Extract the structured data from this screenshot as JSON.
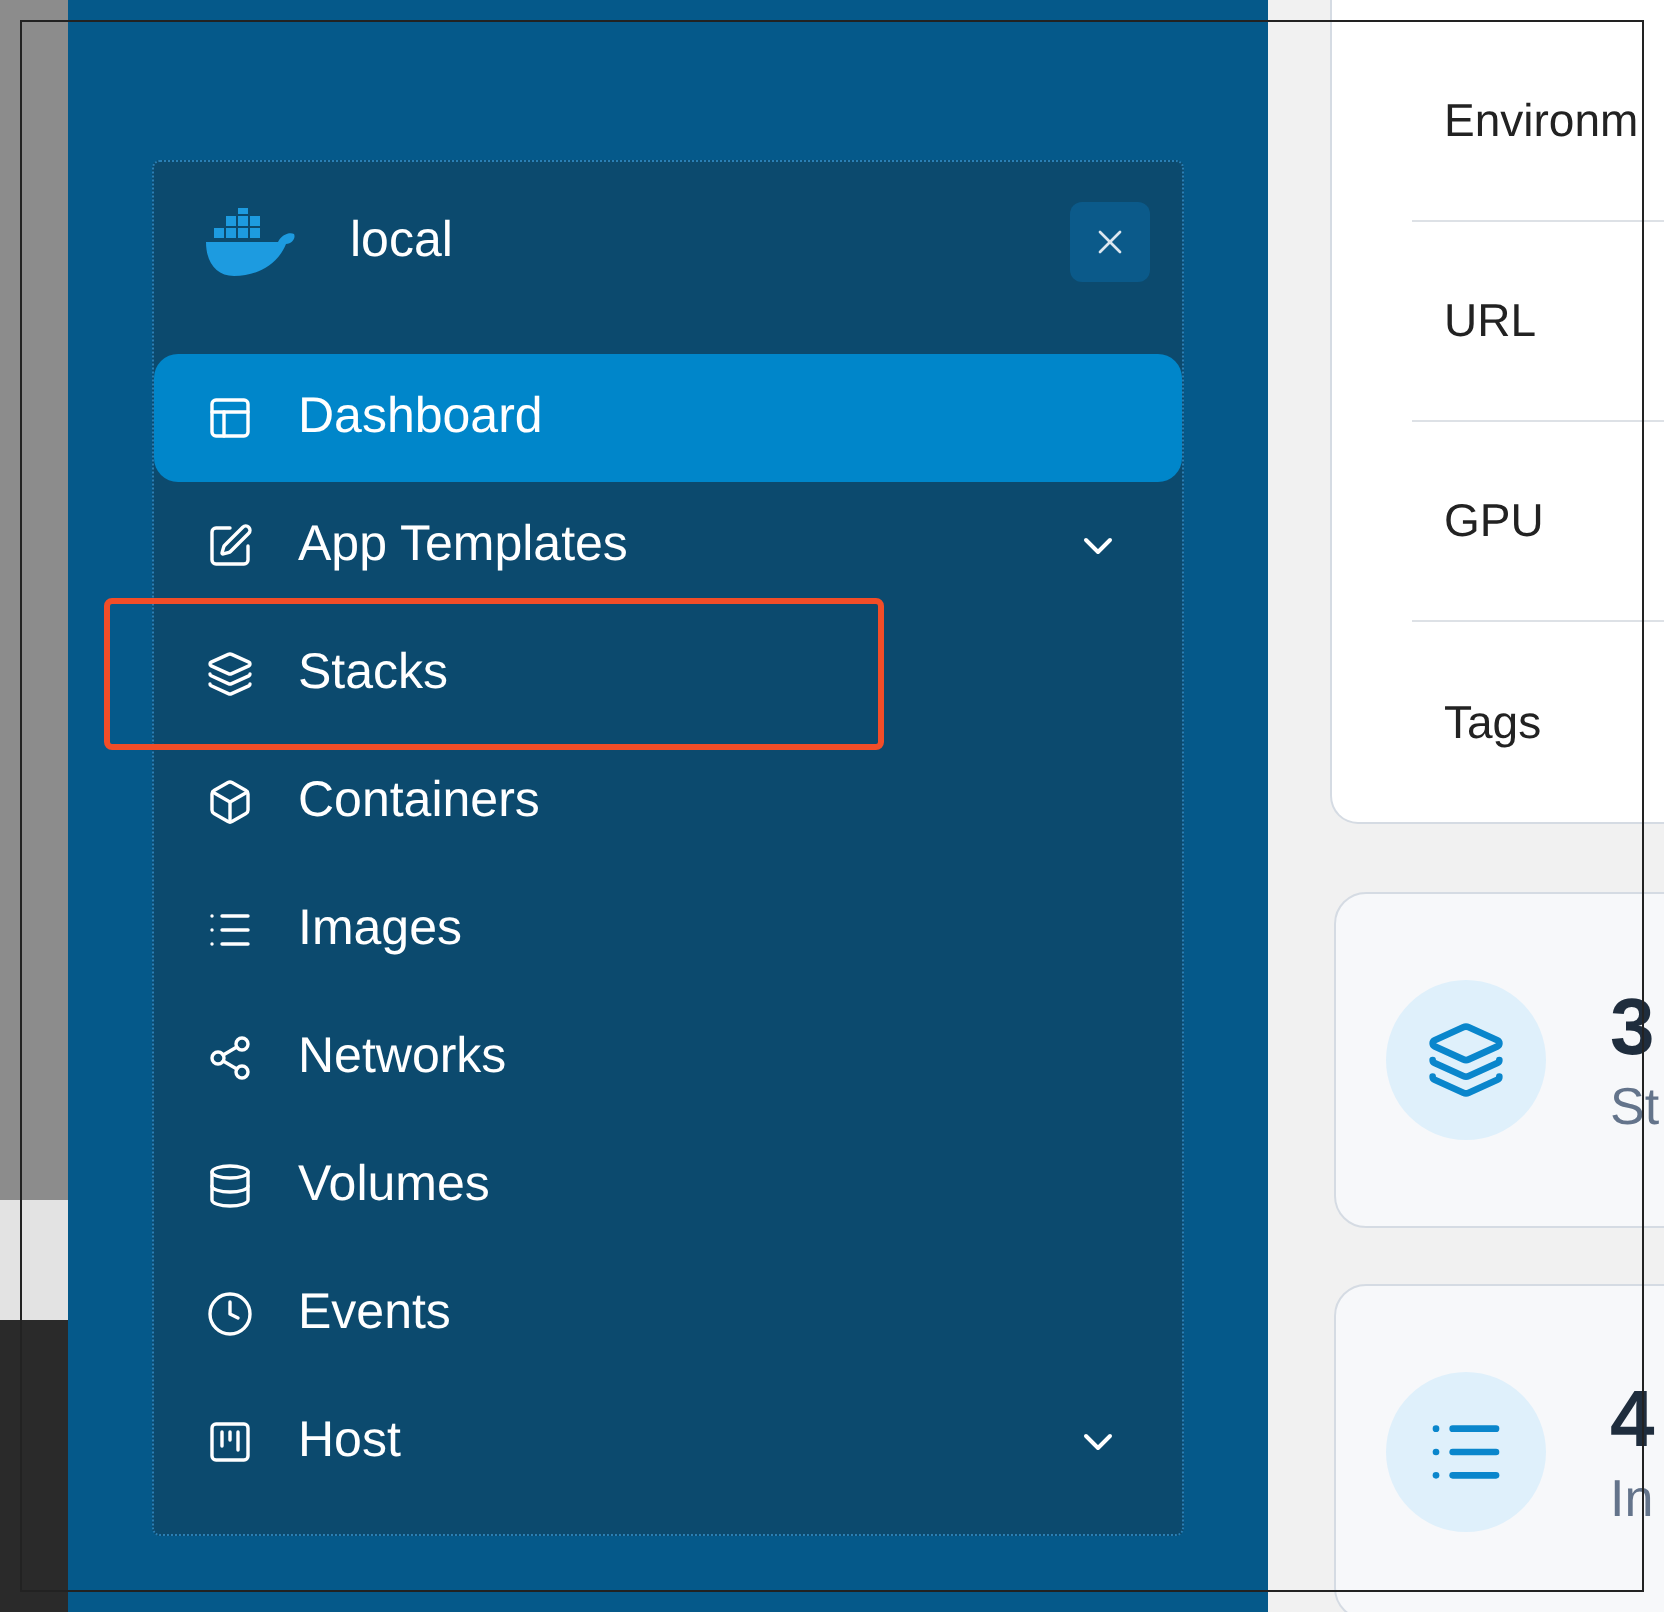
{
  "sidebar": {
    "environment": "local",
    "menu": [
      {
        "label": "Dashboard",
        "kind": "link",
        "selected": true,
        "highlighted": false
      },
      {
        "label": "App Templates",
        "kind": "group",
        "selected": false,
        "highlighted": false
      },
      {
        "label": "Stacks",
        "kind": "link",
        "selected": false,
        "highlighted": true
      },
      {
        "label": "Containers",
        "kind": "link",
        "selected": false,
        "highlighted": false
      },
      {
        "label": "Images",
        "kind": "link",
        "selected": false,
        "highlighted": false
      },
      {
        "label": "Networks",
        "kind": "link",
        "selected": false,
        "highlighted": false
      },
      {
        "label": "Volumes",
        "kind": "link",
        "selected": false,
        "highlighted": false
      },
      {
        "label": "Events",
        "kind": "link",
        "selected": false,
        "highlighted": false
      },
      {
        "label": "Host",
        "kind": "group",
        "selected": false,
        "highlighted": false
      }
    ]
  },
  "details": {
    "rows": [
      "Environm",
      "URL",
      "GPU",
      "Tags"
    ]
  },
  "stats": [
    {
      "value": "3",
      "label": "St"
    },
    {
      "value": "4",
      "label": "In"
    }
  ]
}
